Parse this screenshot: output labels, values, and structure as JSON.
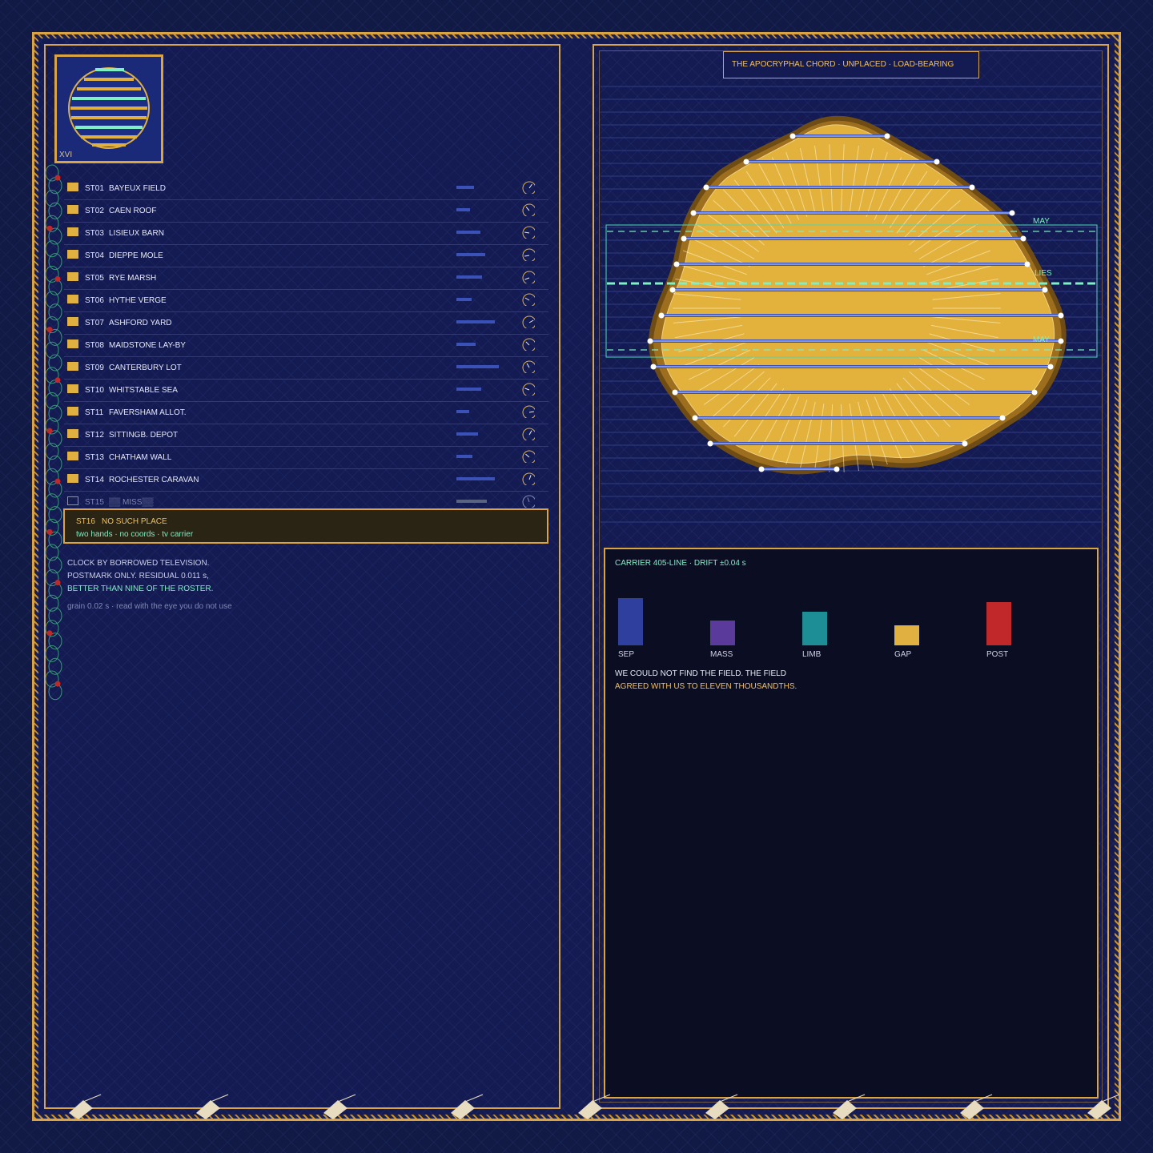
{
  "emblem": {
    "label": "XVI"
  },
  "roster": [
    {
      "code": "ST01",
      "name": "BAYEUX FIELD",
      "bar": 0.35,
      "dial_angle": 35
    },
    {
      "code": "ST02",
      "name": "CAEN ROOF",
      "bar": 0.28,
      "dial_angle": -40
    },
    {
      "code": "ST03",
      "name": "LISIEUX BARN",
      "bar": 0.48,
      "dial_angle": -80
    },
    {
      "code": "ST04",
      "name": "DIEPPE MOLE",
      "bar": 0.58,
      "dial_angle": -100
    },
    {
      "code": "ST05",
      "name": "RYE MARSH",
      "bar": 0.52,
      "dial_angle": -110
    },
    {
      "code": "ST06",
      "name": "HYTHE VERGE",
      "bar": 0.3,
      "dial_angle": -60
    },
    {
      "code": "ST07",
      "name": "ASHFORD YARD",
      "bar": 0.78,
      "dial_angle": 60
    },
    {
      "code": "ST08",
      "name": "MAIDSTONE LAY-BY",
      "bar": 0.38,
      "dial_angle": -45
    },
    {
      "code": "ST09",
      "name": "CANTERBURY LOT",
      "bar": 0.85,
      "dial_angle": -30
    },
    {
      "code": "ST10",
      "name": "WHITSTABLE SEA",
      "bar": 0.5,
      "dial_angle": -70
    },
    {
      "code": "ST11",
      "name": "FAVERSHAM ALLOT.",
      "bar": 0.26,
      "dial_angle": 80
    },
    {
      "code": "ST12",
      "name": "SITTINGB. DEPOT",
      "bar": 0.44,
      "dial_angle": 30
    },
    {
      "code": "ST13",
      "name": "CHATHAM WALL",
      "bar": 0.32,
      "dial_angle": -50
    },
    {
      "code": "ST14",
      "name": "ROCHESTER CARAVAN",
      "bar": 0.77,
      "dial_angle": 20
    },
    {
      "code": "ST15",
      "name": "▒▒ MISS▒▒",
      "bar": 0.62,
      "dial_angle": -20,
      "missing": true
    }
  ],
  "no_such_place": {
    "code": "ST16",
    "name": "NO SUCH PLACE",
    "sub": "two hands · no coords · tv carrier"
  },
  "notes": {
    "line1": "CLOCK BY BORROWED TELEVISION.",
    "line2": "POSTMARK ONLY. RESIDUAL 0.011 s,",
    "line3": "BETTER THAN NINE OF THE ROSTER.",
    "grain": "grain 0.02 s · read with the eye you do not use"
  },
  "chord": {
    "label": "THE APOCRYPHAL CHORD · UNPLACED · LOAD-BEARING",
    "lines": [
      {
        "label": "MAY",
        "color": "#7ef0c4"
      },
      {
        "label": "LIES",
        "color": "#7ef0c4"
      },
      {
        "label": "MAY",
        "color": "#7ef0c4"
      }
    ]
  },
  "carrier": {
    "title": "CARRIER 405-LINE · DRIFT ±0.04 s",
    "categories": [
      {
        "label": "SEP",
        "value": 1.0,
        "color": "#2e3f9e"
      },
      {
        "label": "MASS",
        "value": 0.53,
        "color": "#5a3a9a"
      },
      {
        "label": "LIMB",
        "value": 0.71,
        "color": "#1e8e96"
      },
      {
        "label": "GAP",
        "value": 0.43,
        "color": "#e0b040"
      },
      {
        "label": "POST",
        "value": 0.91,
        "color": "#c0282a"
      }
    ],
    "message1": "WE COULD NOT FIND THE FIELD. THE FIELD",
    "message2": "AGREED WITH US TO ELEVEN THOUSANDTHS."
  },
  "colors": {
    "accent": "#d9a441",
    "mint": "#7ef0c4",
    "gold_fill": "#e3b23c",
    "bar_blue": "#3a52b8"
  }
}
